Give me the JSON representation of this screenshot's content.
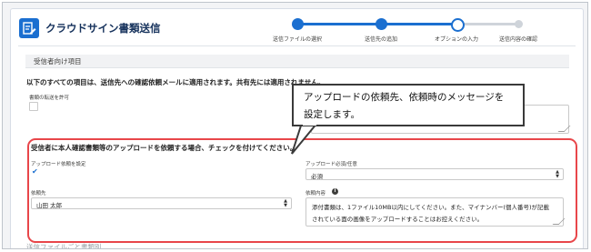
{
  "header": {
    "title": "クラウドサイン書類送信",
    "icon": "document-edit-icon",
    "accent": "#1b6fd0"
  },
  "steps": [
    {
      "label": "送信ファイルの選択",
      "state": "done"
    },
    {
      "label": "送信先の追加",
      "state": "done"
    },
    {
      "label": "オプションの入力",
      "state": "active"
    },
    {
      "label": "送信内容の確認",
      "state": "todo"
    }
  ],
  "section": {
    "title": "受信者向け項目",
    "note": "以下のすべての項目は、送信先への確認依頼メールに適用されます。共有先には適用されません。",
    "transfer_label": "書類の転送を許可"
  },
  "upload_section": {
    "note": "受信者に本人確認書類等のアップロードを依頼する場合、チェックを付けてください。",
    "request_label": "アップロード依頼を設定",
    "request_checked": true,
    "required_label": "アップロード必須/任意",
    "required_value": "必須",
    "requestee_label": "依頼先",
    "requestee_value": "山田 太郎",
    "message_label": "依頼内容",
    "message_lines": [
      "添付書類は、1ファイル10MB以内にしてください。また、マイナンバー(個人番号)が記載",
      "されている面の画像をアップロードすることはお控えください。"
    ],
    "highlight_color": "#e8464a"
  },
  "callout": {
    "lines": [
      "アップロードの依頼先、依頼時のメッセージを",
      "設定します。"
    ]
  },
  "footer_fragment": "送信ファイルごと書類別"
}
